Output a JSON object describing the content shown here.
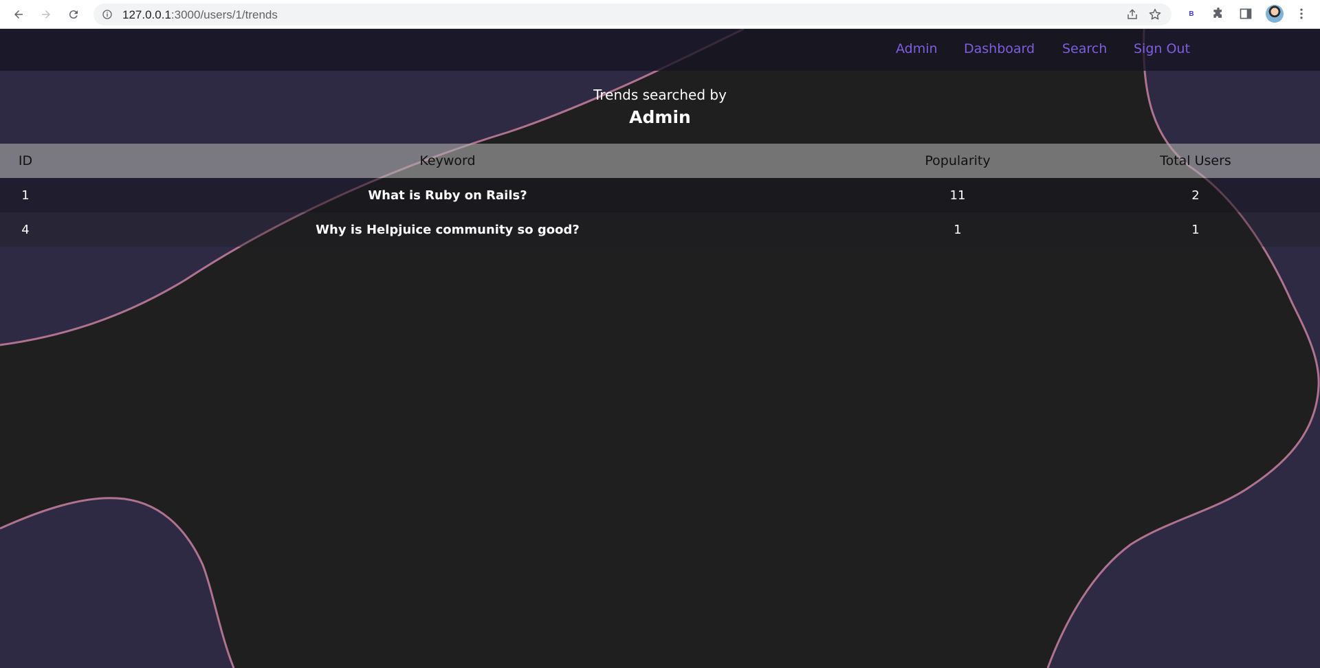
{
  "browser": {
    "url_host": "127.0.0.1",
    "url_path": ":3000/users/1/trends",
    "extension_label": "B"
  },
  "nav": {
    "links": [
      "Admin",
      "Dashboard",
      "Search",
      "Sign Out"
    ]
  },
  "heading": {
    "subtitle": "Trends searched by",
    "user": "Admin"
  },
  "table": {
    "headers": [
      "ID",
      "Keyword",
      "Popularity",
      "Total Users"
    ],
    "rows": [
      [
        "1",
        "What is Ruby on Rails?",
        "11",
        "2"
      ],
      [
        "4",
        "Why is Helpjuice community so good?",
        "1",
        "1"
      ]
    ]
  },
  "colors": {
    "link": "#7f5fe0",
    "background": "#1f1f1f",
    "blob": "#2e2a43",
    "blob_outline": "#b0738f"
  }
}
